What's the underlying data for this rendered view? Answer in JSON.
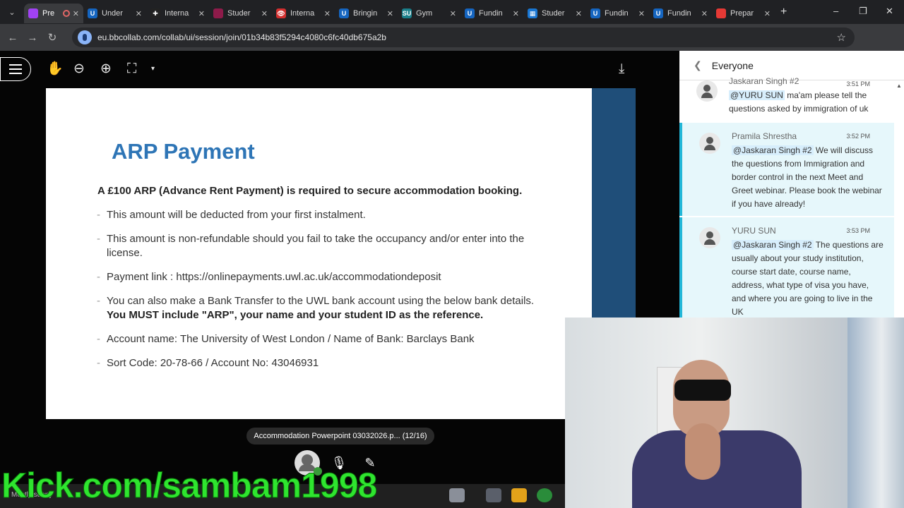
{
  "browser": {
    "tabs": [
      {
        "label": "Pre",
        "favicon_color": "#a142f4",
        "favicon_text": "",
        "active": true,
        "recording": true
      },
      {
        "label": "Under",
        "favicon_color": "#1565c0",
        "favicon_text": "U"
      },
      {
        "label": "Interna",
        "favicon_color": "#222222",
        "favicon_text": "✚"
      },
      {
        "label": "Studer",
        "favicon_color": "#8e1b4a",
        "favicon_text": ""
      },
      {
        "label": "Interna",
        "favicon_color": "#d32f2f",
        "favicon_text": "👁"
      },
      {
        "label": "Bringin",
        "favicon_color": "#1565c0",
        "favicon_text": "U"
      },
      {
        "label": "Gym",
        "favicon_color": "#1a7f8a",
        "favicon_text": "SU"
      },
      {
        "label": "Fundin",
        "favicon_color": "#1565c0",
        "favicon_text": "U"
      },
      {
        "label": "Studer",
        "favicon_color": "#1976d2",
        "favicon_text": "▦"
      },
      {
        "label": "Fundin",
        "favicon_color": "#1565c0",
        "favicon_text": "U"
      },
      {
        "label": "Fundin",
        "favicon_color": "#1565c0",
        "favicon_text": "U"
      },
      {
        "label": "Prepar",
        "favicon_color": "#e53935",
        "favicon_text": ""
      }
    ],
    "url": "eu.bbcollab.com/collab/ui/session/join/01b34b83f5294c4080c6fc40db675a2b"
  },
  "slide": {
    "title": "ARP Payment",
    "lead": "A £100 ARP (Advance Rent Payment) is required to secure accommodation booking.",
    "bullets": [
      {
        "text": "This amount will be deducted from your first instalment.",
        "bold": ""
      },
      {
        "text": "This amount is non-refundable should you fail to take the occupancy and/or enter into the license.",
        "bold": ""
      },
      {
        "text": "Payment link : https://onlinepayments.uwl.ac.uk/accommodationdeposit",
        "bold": ""
      },
      {
        "text": "You can also make a Bank Transfer to the UWL bank account using the below bank details. ",
        "bold": "You MUST include \"ARP\", your name and your student ID as the reference."
      },
      {
        "text": "Account name: The University of West London / Name of Bank: Barclays Bank",
        "bold": ""
      },
      {
        "text": "Sort Code: 20-78-66 / Account No: 43046931",
        "bold": ""
      }
    ]
  },
  "document_pill": "Accommodation Powerpoint 03032026.p...   (12/16)",
  "chat": {
    "header": "Everyone",
    "messages": [
      {
        "name": "Jaskaran Singh #2",
        "time": "3:51 PM",
        "mention": "@YURU SUN",
        "text": " ma'am please tell the questions asked by immigration of uk",
        "highlight": false
      },
      {
        "name": "Pramila Shrestha",
        "time": "3:52 PM",
        "mention": "@Jaskaran Singh #2",
        "text": "  We will discuss the questions from Immigration and border control in the next Meet and Greet webinar. Please book the webinar if you have already!",
        "highlight": true
      },
      {
        "name": "YURU SUN",
        "time": "3:53 PM",
        "mention": "@Jaskaran Singh #2",
        "text": "  The questions are usually about your study institution, course start date, course name, address, what type of visa you have, and where you are going to live in the UK",
        "highlight": true
      }
    ]
  },
  "taskbar": {
    "weather": "Mostly sunny"
  },
  "overlay_text": "Kick.com/sambam1998"
}
